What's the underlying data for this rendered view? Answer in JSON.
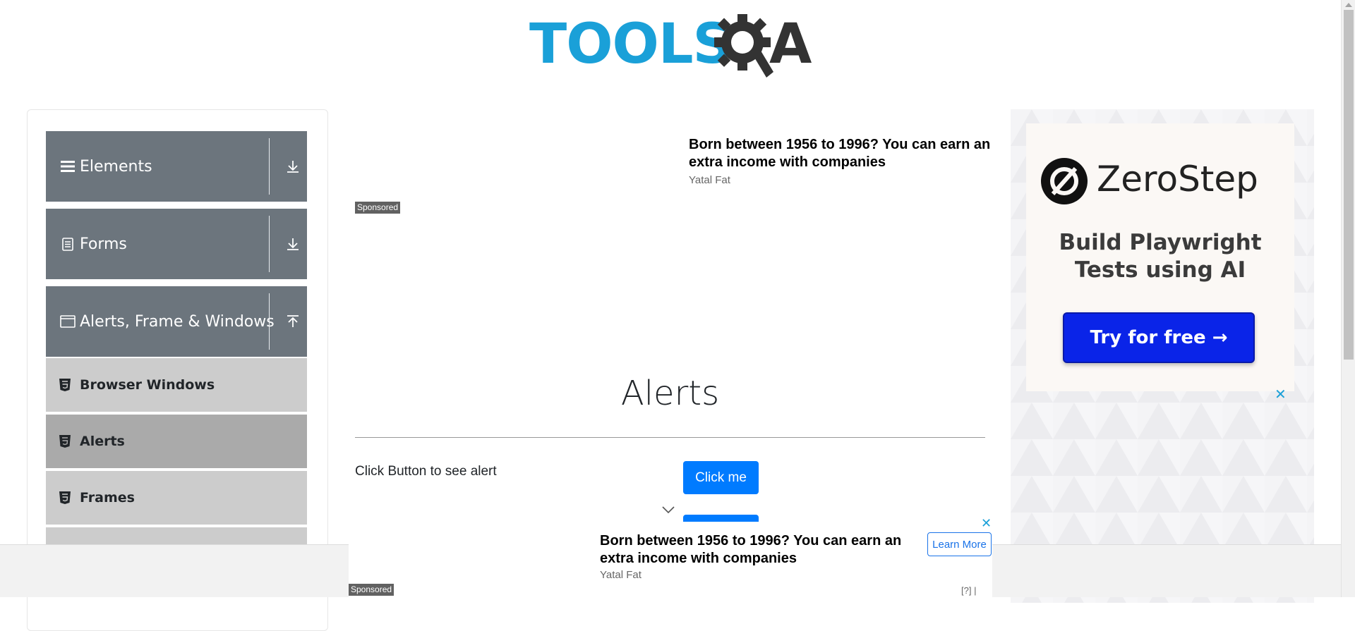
{
  "header": {
    "logo_text": "TOOLS",
    "logo_suffix": "A"
  },
  "sidebar": {
    "groups": [
      {
        "label": "Elements",
        "icon": "hamburger-icon",
        "arrow": "download-arrow-icon"
      },
      {
        "label": "Forms",
        "icon": "form-document-icon",
        "arrow": "download-arrow-icon"
      },
      {
        "label": "Alerts, Frame & Windows",
        "icon": "window-icon",
        "arrow": "upload-arrow-icon"
      }
    ],
    "items": [
      {
        "label": "Browser Windows",
        "icon": "html5-icon"
      },
      {
        "label": "Alerts",
        "icon": "html5-icon",
        "active": true
      },
      {
        "label": "Frames",
        "icon": "html5-icon"
      }
    ]
  },
  "top_ad": {
    "headline": "Born between 1956 to 1996? You can earn an extra income with companies",
    "source": "Yatal Fat",
    "sponsored_label": "Sponsored"
  },
  "main": {
    "title": "Alerts",
    "rows": [
      {
        "label": "Click Button to see alert",
        "button": "Click me"
      }
    ]
  },
  "right_ad": {
    "brand": "ZeroStep",
    "headline": "Build Playwright Tests using AI",
    "cta": "Try for free →",
    "close": "✕"
  },
  "bottom_ad": {
    "headline": "Born between 1956 to 1996? You can earn an extra income with companies",
    "source": "Yatal Fat",
    "learn_more": "Learn More",
    "sponsored_label": "Sponsored",
    "help": "[?] |",
    "close": "✕"
  },
  "colors": {
    "primary": "#007bff",
    "sidebar_header": "#6c757d",
    "sidebar_item": "#cccccc",
    "sidebar_item_active": "#aaaaaa",
    "logo_blue": "#1aa0d8",
    "cta_blue": "#0a24e8"
  }
}
